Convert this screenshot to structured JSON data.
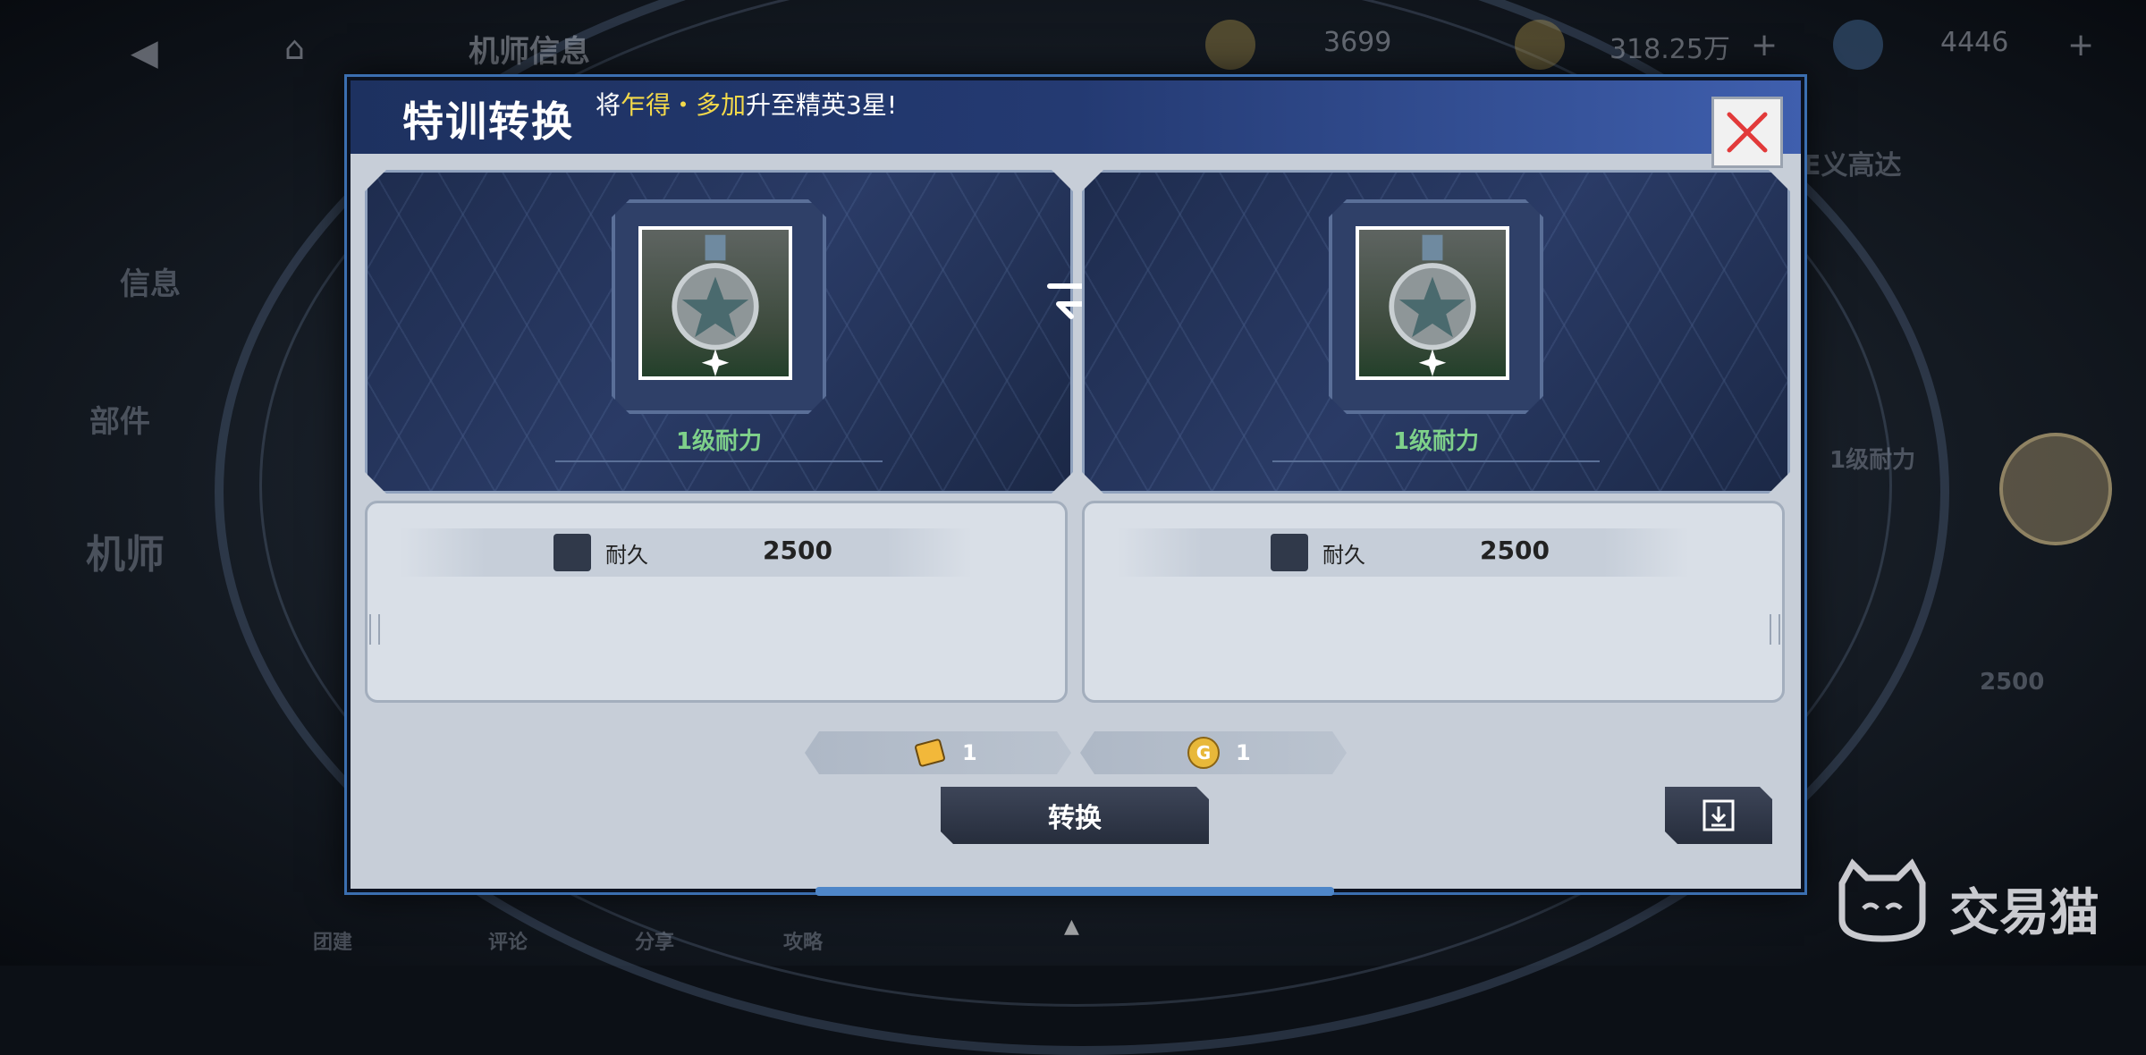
{
  "background": {
    "top_bar": {
      "title": "机师信息",
      "resource1": "3699",
      "resource2": "318.25万",
      "resource3": "4446"
    },
    "side_menu": [
      "信息",
      "部件",
      "机师"
    ],
    "right_labels": {
      "name": "E义高达",
      "stat": "1级耐力",
      "value": "2500"
    },
    "bottom_tabs": [
      "团建",
      "评论",
      "分享",
      "攻略"
    ]
  },
  "dialog": {
    "title": "特训转换",
    "subtitle_prefix": "将",
    "subtitle_highlight": "乍得・多加",
    "subtitle_suffix": "升至精英3星!",
    "close_icon": "close-x-icon",
    "left_card": {
      "label": "1级耐力",
      "stat_name": "耐久",
      "stat_value": "2500"
    },
    "right_card": {
      "label": "1级耐力",
      "stat_name": "耐久",
      "stat_value": "2500"
    },
    "costs": [
      {
        "icon": "training-disk-icon",
        "amount": "1"
      },
      {
        "icon": "gold-coin-icon",
        "amount": "1"
      }
    ],
    "convert_label": "转换",
    "save_icon": "download-icon"
  },
  "watermark": "交易猫",
  "colors": {
    "header_blue": "#243a72",
    "highlight_yellow": "#f3d94a",
    "skill_green": "#7ed08a",
    "close_red": "#e23a3a"
  }
}
